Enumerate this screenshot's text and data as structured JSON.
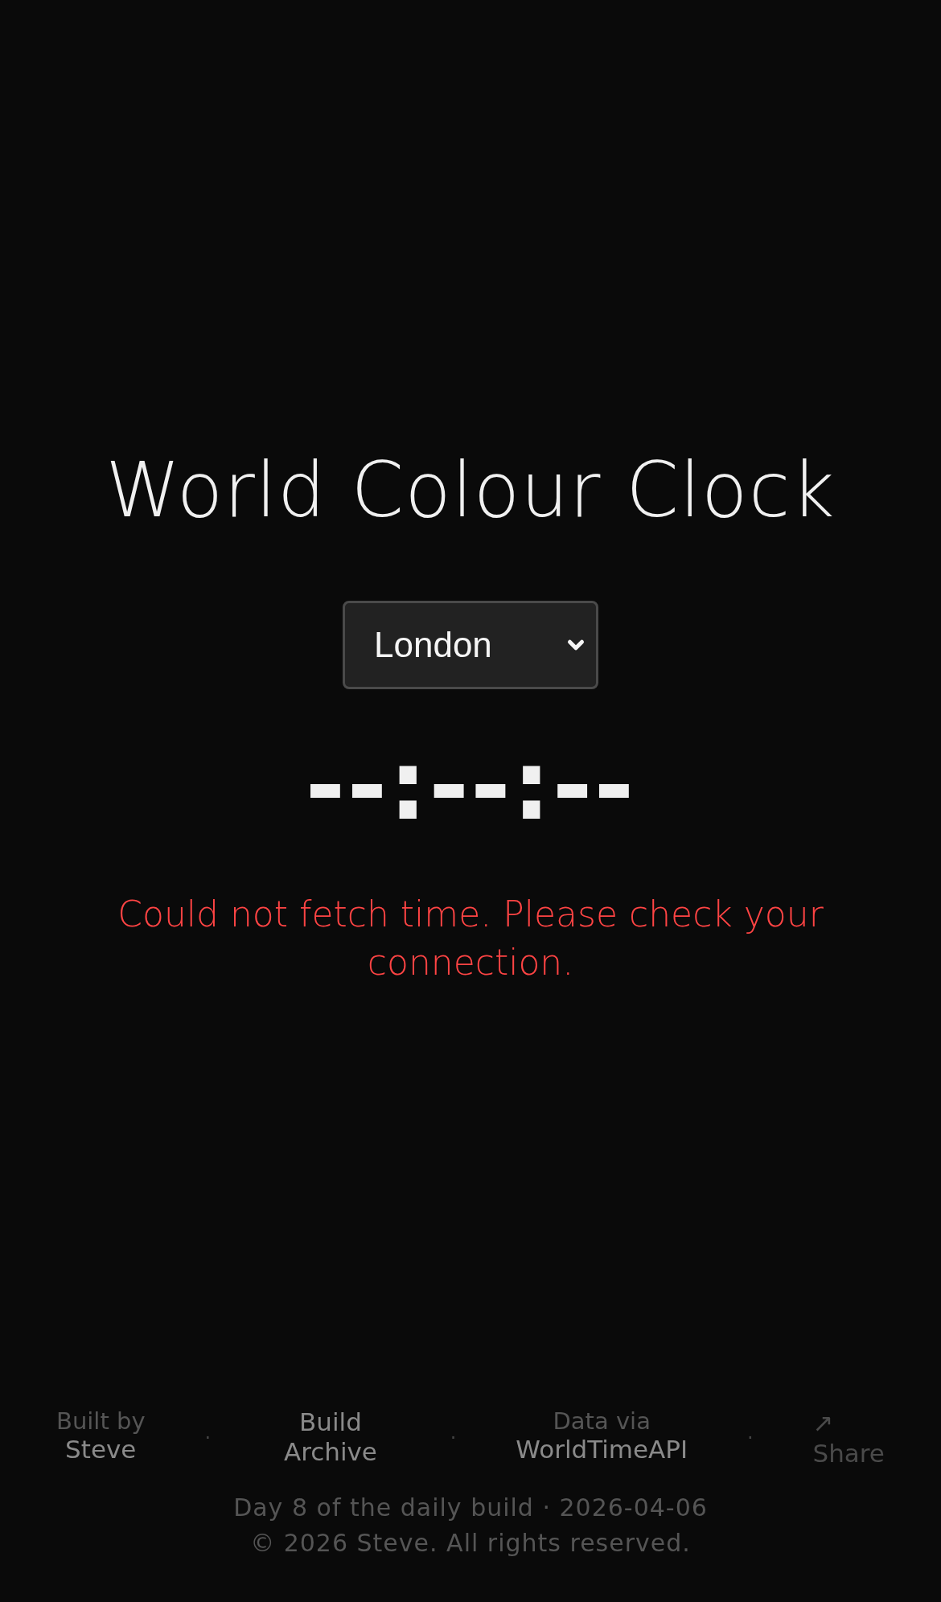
{
  "title": "World Colour Clock",
  "city_select": {
    "value": "London"
  },
  "clock": "--:--:--",
  "error": "Could not fetch time. Please check your connection.",
  "footer": {
    "items": [
      {
        "kind": "credit",
        "label": "Built by",
        "link": "Steve"
      },
      {
        "kind": "separator",
        "text": "·"
      },
      {
        "kind": "link",
        "link": "Build Archive"
      },
      {
        "kind": "separator",
        "text": "·"
      },
      {
        "kind": "credit",
        "label": "Data via",
        "link": "WorldTimeAPI"
      },
      {
        "kind": "separator",
        "text": "·"
      },
      {
        "kind": "share",
        "icon": "↗",
        "link": "Share"
      }
    ],
    "build_line": "Day 8 of the daily build · 2026-04-06",
    "copyright": "© 2026 Steve. All rights reserved."
  }
}
